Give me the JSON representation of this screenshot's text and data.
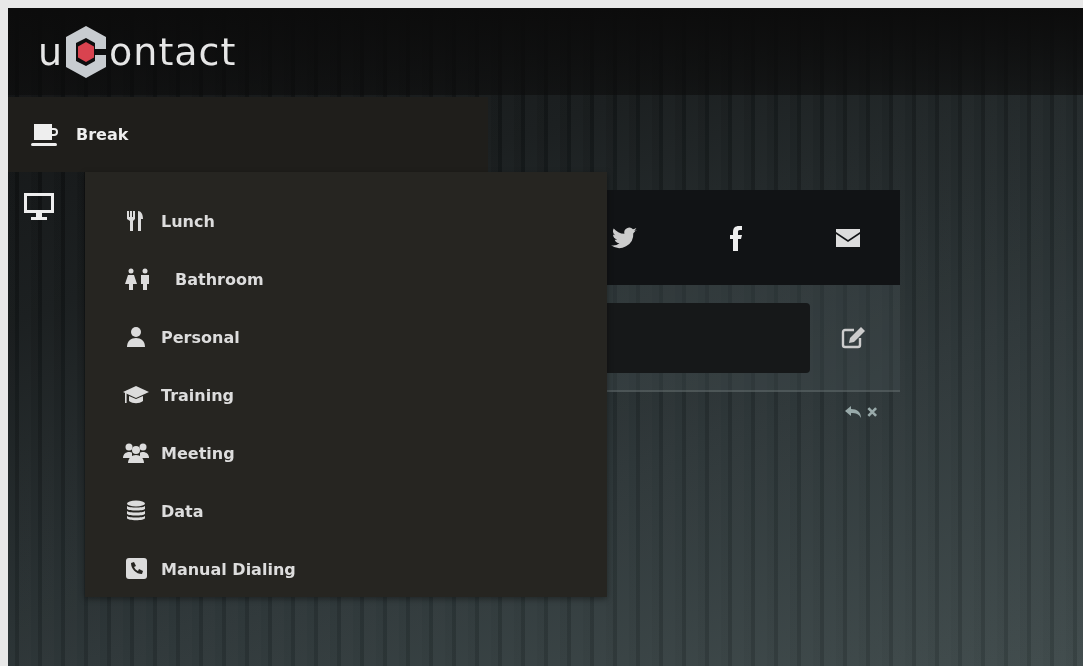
{
  "logo": {
    "prefix": "u",
    "suffix": "ontact"
  },
  "status_menu": {
    "label": "Break",
    "expanded": true
  },
  "break_options": [
    {
      "label": "Lunch"
    },
    {
      "label": "Bathroom"
    },
    {
      "label": "Personal"
    },
    {
      "label": "Training"
    },
    {
      "label": "Meeting"
    },
    {
      "label": "Data"
    },
    {
      "label": "Manual Dialing"
    }
  ]
}
